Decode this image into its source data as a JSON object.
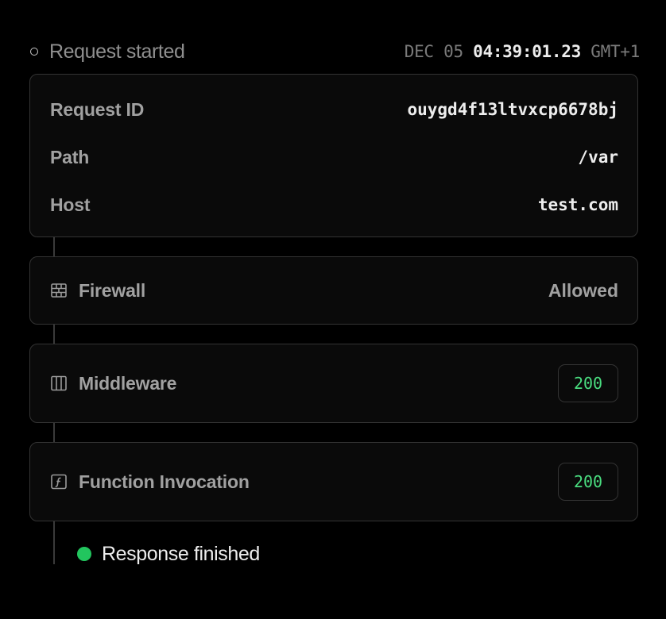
{
  "header": {
    "label": "Request started",
    "date": "DEC 05",
    "time": "04:39:01.23",
    "timezone": "GMT+1"
  },
  "request": {
    "fields": [
      {
        "label": "Request ID",
        "value": "ouygd4f13ltvxcp6678bj"
      },
      {
        "label": "Path",
        "value": "/var"
      },
      {
        "label": "Host",
        "value": "test.com"
      }
    ]
  },
  "steps": [
    {
      "title": "Firewall",
      "icon": "firewall-brick-icon",
      "result": "Allowed"
    },
    {
      "title": "Middleware",
      "icon": "middleware-columns-icon",
      "status": "200"
    },
    {
      "title": "Function Invocation",
      "icon": "function-icon",
      "status": "200"
    }
  ],
  "footer": {
    "label": "Response finished",
    "status_color": "#22c55e"
  },
  "colors": {
    "background": "#000000",
    "border": "#333333",
    "success": "#4ade80",
    "muted": "#a1a1a1"
  }
}
